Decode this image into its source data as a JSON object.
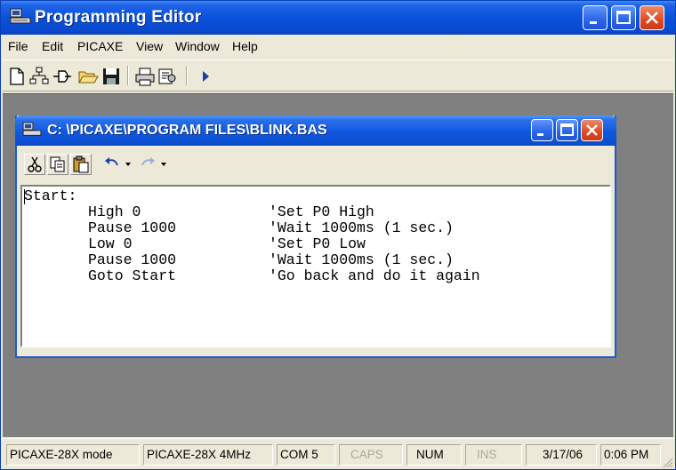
{
  "window": {
    "title": "Programming Editor",
    "colors": {
      "titlebar": "#0a52da",
      "close": "#de4a22",
      "mdi_background": "#808080",
      "face": "#ece9d8"
    }
  },
  "menu": {
    "items": [
      {
        "label": "File"
      },
      {
        "label": "Edit"
      },
      {
        "label": "PICAXE"
      },
      {
        "label": "View"
      },
      {
        "label": "Window"
      },
      {
        "label": "Help"
      }
    ]
  },
  "toolbar": {
    "icons": [
      "new-file-icon",
      "flowchart-icon",
      "convert-icon",
      "open-folder-icon",
      "save-icon",
      "print-icon",
      "options-icon",
      "run-icon"
    ]
  },
  "child_window": {
    "title": "C: \\PICAXE\\PROGRAM FILES\\BLINK.BAS",
    "toolbar_icons": [
      "cut-icon",
      "copy-icon",
      "paste-icon",
      "undo-icon",
      "undo-dropdown-icon",
      "redo-icon",
      "redo-dropdown-icon"
    ]
  },
  "editor": {
    "label": "Start:",
    "lines": [
      {
        "code": "High 0",
        "comment": "'Set P0 High"
      },
      {
        "code": "Pause 1000",
        "comment": "'Wait 1000ms (1 sec.)"
      },
      {
        "code": "Low 0",
        "comment": "'Set P0 Low"
      },
      {
        "code": "Pause 1000",
        "comment": "'Wait 1000ms (1 sec.)"
      },
      {
        "code": "Goto Start",
        "comment": "'Go back and do it again"
      }
    ]
  },
  "statusbar": {
    "mode": "PICAXE-28X mode",
    "device": "PICAXE-28X 4MHz",
    "port": "COM 5",
    "caps": "CAPS",
    "num": "NUM",
    "ins": "INS",
    "date": "3/17/06",
    "time": "0:06 PM"
  }
}
